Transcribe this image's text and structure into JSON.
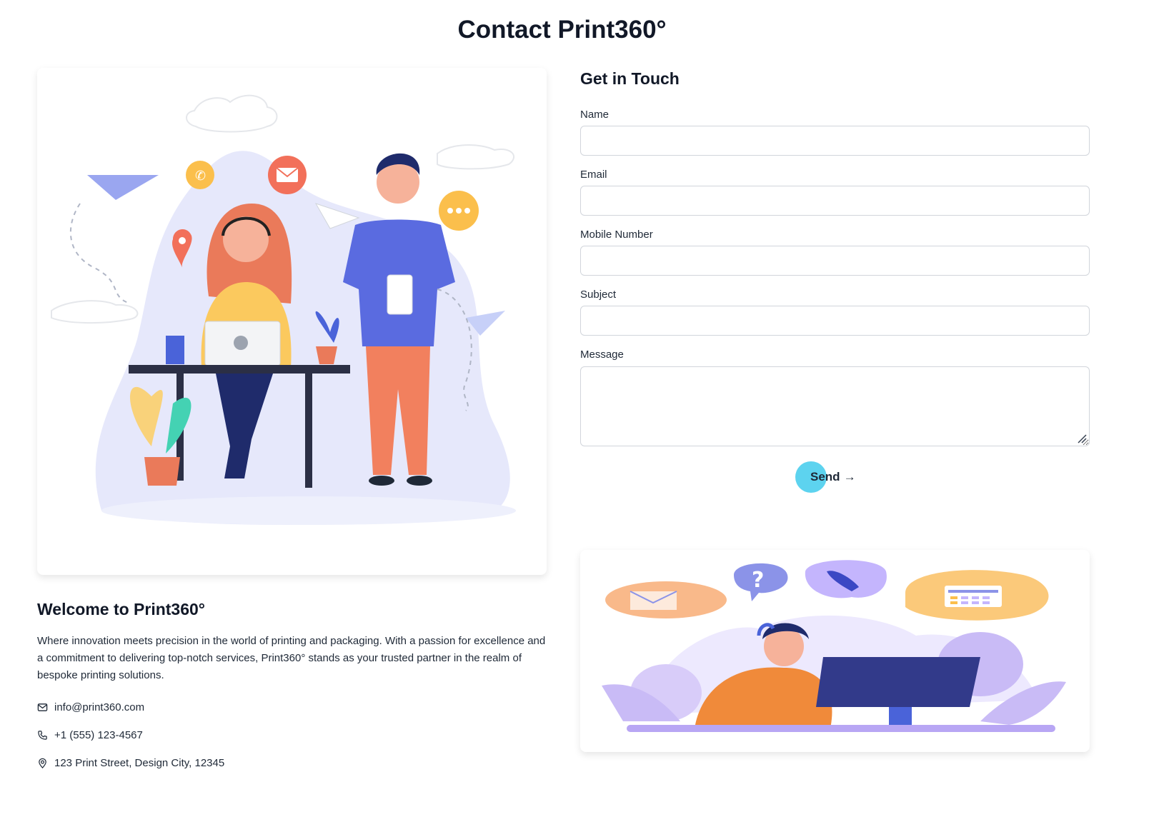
{
  "page": {
    "title": "Contact Print360°"
  },
  "welcome": {
    "title": "Welcome to Print360°",
    "text": "Where innovation meets precision in the world of printing and packaging. With a passion for excellence and a commitment to delivering top-notch services, Print360° stands as your trusted partner in the realm of bespoke printing solutions."
  },
  "contact": {
    "email": "info@print360.com",
    "phone": "+1 (555) 123-4567",
    "address": "123 Print Street, Design City, 12345"
  },
  "form": {
    "title": "Get in Touch",
    "fields": [
      {
        "label": "Name",
        "value": ""
      },
      {
        "label": "Email",
        "value": ""
      },
      {
        "label": "Mobile Number",
        "value": ""
      },
      {
        "label": "Subject",
        "value": ""
      },
      {
        "label": "Message",
        "value": ""
      }
    ],
    "send_label": "Send",
    "send_arrow": "→"
  },
  "icons": {
    "email": "mail-icon",
    "phone": "phone-icon",
    "address": "map-pin-icon"
  },
  "colors": {
    "accent": "#5dd3ef",
    "text": "#111827",
    "border": "#d1d5db"
  }
}
